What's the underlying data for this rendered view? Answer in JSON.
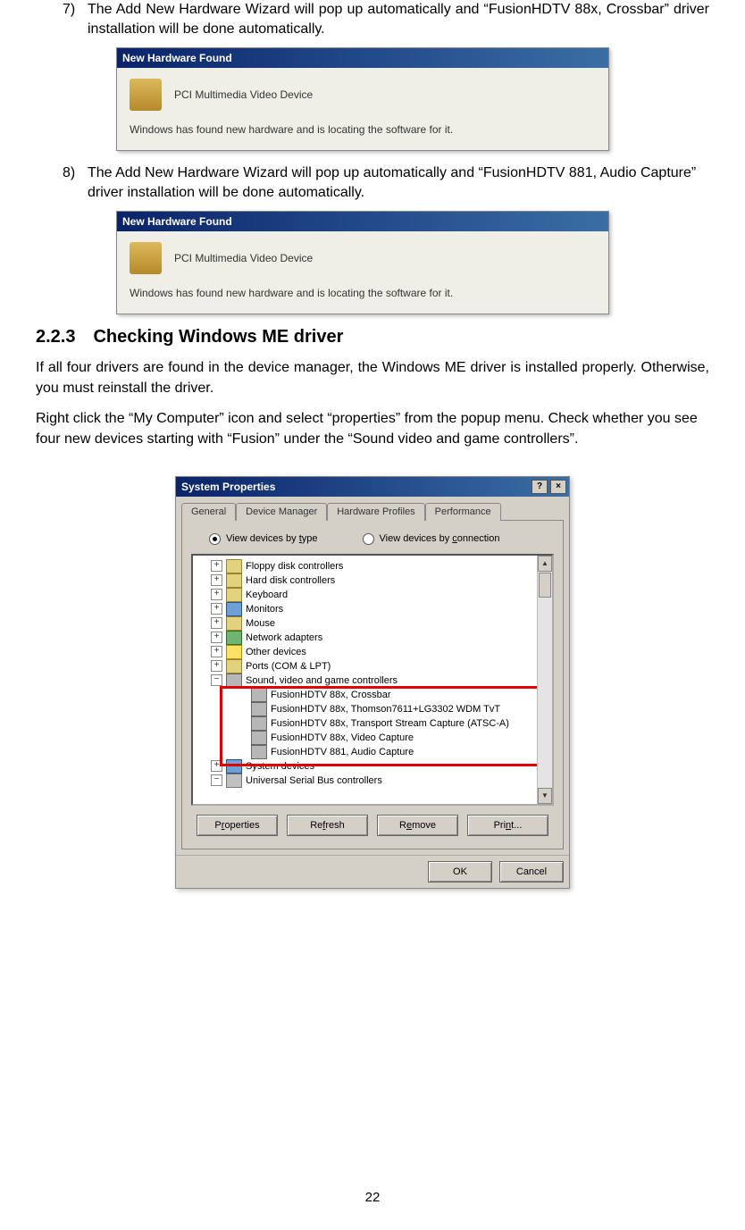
{
  "items": [
    {
      "num": "7)",
      "text": "The Add New Hardware Wizard will pop up automatically and “FusionHDTV 88x, Crossbar” driver installation will be done automatically."
    },
    {
      "num": "8)",
      "text": "The Add New Hardware Wizard will pop up automatically and “FusionHDTV 881, Audio Capture” driver installation will be done automatically."
    }
  ],
  "hwfound": {
    "title": "New Hardware Found",
    "device": "PCI Multimedia Video Device",
    "msg": "Windows has found new hardware and is locating the software for it."
  },
  "section": {
    "head": "2.2.3 Checking Windows ME driver",
    "p1": "If all four drivers are found in the device manager, the Windows ME driver is installed properly. Otherwise, you must reinstall the driver.",
    "p2": "Right click the “My Computer” icon and select “properties” from the popup menu. Check whether you see four new devices starting with “Fusion” under the “Sound video and game controllers”."
  },
  "sysprops": {
    "title": "System Properties",
    "help": "?",
    "close": "×",
    "tabs": [
      "General",
      "Device Manager",
      "Hardware Profiles",
      "Performance"
    ],
    "radio1": "View devices by type",
    "radio2": "View devices by connection",
    "tree": [
      {
        "exp": "+",
        "icon": "ic-folder",
        "label": "Floppy disk controllers"
      },
      {
        "exp": "+",
        "icon": "ic-folder",
        "label": "Hard disk controllers"
      },
      {
        "exp": "+",
        "icon": "ic-folder",
        "label": "Keyboard"
      },
      {
        "exp": "+",
        "icon": "ic-monitor",
        "label": "Monitors"
      },
      {
        "exp": "+",
        "icon": "ic-folder",
        "label": "Mouse"
      },
      {
        "exp": "+",
        "icon": "ic-net",
        "label": "Network adapters"
      },
      {
        "exp": "+",
        "icon": "ic-q",
        "label": "Other devices"
      },
      {
        "exp": "+",
        "icon": "ic-folder",
        "label": "Ports (COM & LPT)"
      },
      {
        "exp": "−",
        "icon": "ic-sound",
        "label": "Sound, video and game controllers"
      }
    ],
    "fusion": [
      "FusionHDTV 88x, Crossbar",
      "FusionHDTV 88x, Thomson7611+LG3302 WDM TvT",
      "FusionHDTV 88x, Transport Stream Capture (ATSC-A)",
      "FusionHDTV 88x, Video Capture",
      "FusionHDTV 881, Audio Capture"
    ],
    "after": [
      {
        "exp": "+",
        "icon": "ic-monitor",
        "label": "System devices"
      },
      {
        "exp": "−",
        "icon": "ic-usb",
        "label": "Universal Serial Bus controllers"
      }
    ],
    "buttons": {
      "properties": "Properties",
      "refresh": "Refresh",
      "remove": "Remove",
      "print": "Print..."
    },
    "footer": {
      "ok": "OK",
      "cancel": "Cancel"
    }
  },
  "pagenum": "22"
}
